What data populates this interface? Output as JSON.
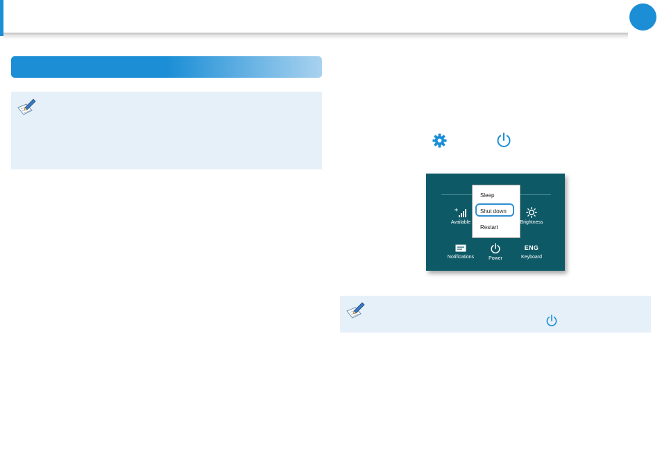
{
  "power_menu": {
    "sleep": "Sleep",
    "shut_down": "Shut down",
    "restart": "Restart"
  },
  "settings_tiles": {
    "network": "Available",
    "brightness": "Brightness",
    "notifications": "Notifications",
    "power": "Power",
    "keyboard": "Keyboard",
    "keyboard_lang": "ENG"
  },
  "colors": {
    "accent_blue": "#1b8ed6",
    "note_background": "#e6f0f9",
    "panel_teal": "#0e5966",
    "highlight_ring": "#2d8fd2"
  },
  "icons": {
    "note": "note-pencil-icon",
    "settings": "gear-icon",
    "power": "power-icon",
    "network": "network-signal-icon",
    "brightness": "sun-icon",
    "notifications": "message-icon"
  }
}
